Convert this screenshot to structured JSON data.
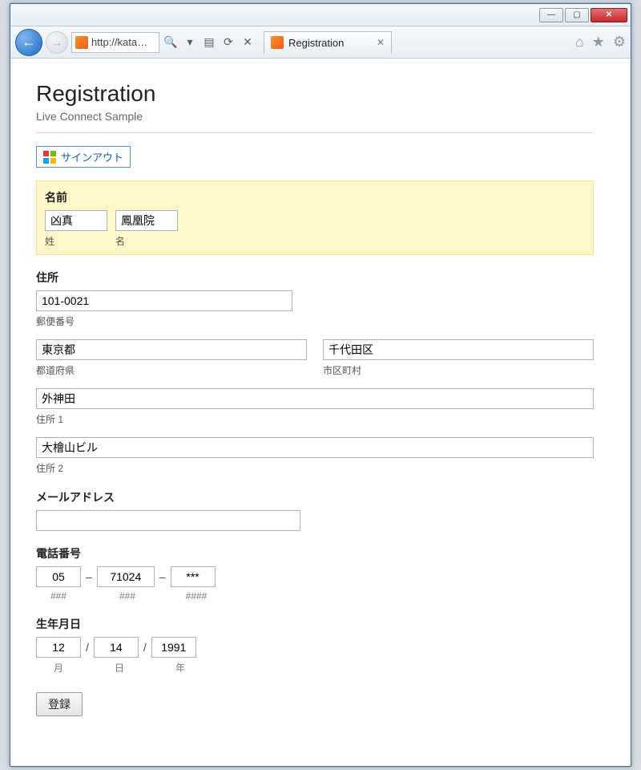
{
  "window": {
    "url": "http://kata…",
    "tab_title": "Registration"
  },
  "page": {
    "title": "Registration",
    "subtitle": "Live Connect Sample",
    "signout": "サインアウト"
  },
  "name": {
    "section": "名前",
    "last_value": "凶真",
    "first_value": "鳳凰院",
    "last_caption": "姓",
    "first_caption": "名"
  },
  "address": {
    "section": "住所",
    "postal_value": "101-0021",
    "postal_caption": "郵便番号",
    "pref_value": "東京都",
    "pref_caption": "都道府県",
    "city_value": "千代田区",
    "city_caption": "市区町村",
    "line1_value": "外神田",
    "line1_caption": "住所 1",
    "line2_value": "大檜山ビル",
    "line2_caption": "住所 2"
  },
  "email": {
    "section": "メールアドレス",
    "value": ""
  },
  "phone": {
    "section": "電話番号",
    "p1": "05",
    "p2": "71024",
    "p3": "***",
    "c1": "###",
    "c2": "###",
    "c3": "####"
  },
  "dob": {
    "section": "生年月日",
    "month": "12",
    "day": "14",
    "year": "1991",
    "c_month": "月",
    "c_day": "日",
    "c_year": "年"
  },
  "submit": "登録"
}
